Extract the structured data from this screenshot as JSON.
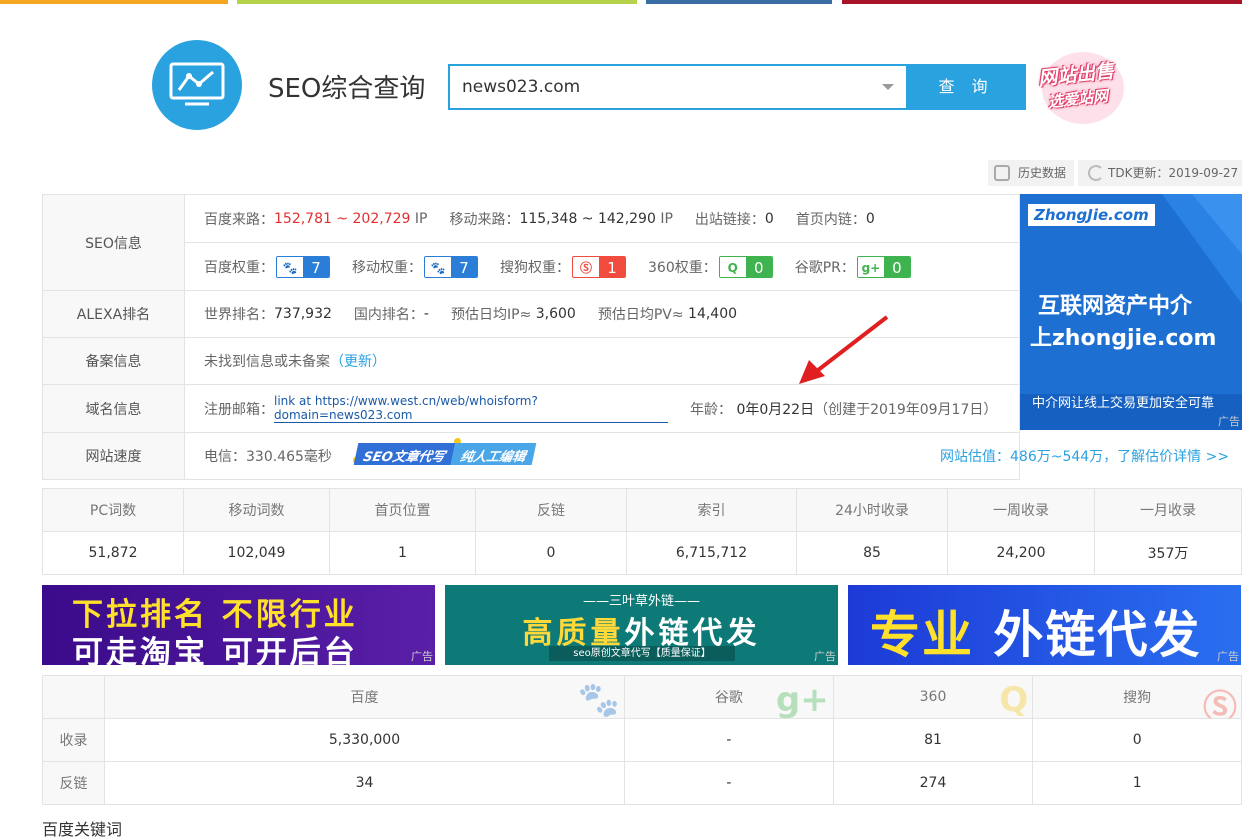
{
  "header": {
    "title": "SEO综合查询",
    "search_value": "news023.com",
    "search_button": "查 询",
    "sale_badge_line1": "网站出售",
    "sale_badge_line2": "选爱站网"
  },
  "toolbar": {
    "history": "历史数据",
    "tdk": "TDK更新：2019-09-27"
  },
  "seo_info": {
    "label": "SEO信息",
    "baidu_traffic_label": "百度来路：",
    "baidu_traffic_value": "152,781 ~ 202,729",
    "baidu_traffic_unit": "IP",
    "mobile_traffic_label": "移动来路：",
    "mobile_traffic_value": "115,348 ~ 142,290",
    "mobile_traffic_unit": "IP",
    "outlinks_label": "出站链接：",
    "outlinks_value": "0",
    "homepage_links_label": "首页内链：",
    "homepage_links_value": "0",
    "baidu_weight_label": "百度权重：",
    "baidu_weight_value": "7",
    "mobile_weight_label": "移动权重：",
    "mobile_weight_value": "7",
    "sogou_weight_label": "搜狗权重：",
    "sogou_weight_value": "1",
    "weight360_label": "360权重：",
    "weight360_value": "0",
    "google_pr_label": "谷歌PR：",
    "google_pr_value": "0"
  },
  "alexa": {
    "label": "ALEXA排名",
    "world_label": "世界排名：",
    "world_value": "737,932",
    "domestic_label": "国内排名：",
    "domestic_value": "-",
    "ip_label": "预估日均IP≈",
    "ip_value": "3,600",
    "pv_label": "预估日均PV≈",
    "pv_value": "14,400"
  },
  "beian": {
    "label": "备案信息",
    "text": "未找到信息或未备案",
    "update": "（更新）"
  },
  "domain": {
    "label": "域名信息",
    "email_label": "注册邮箱：",
    "email_link": "link at https://www.west.cn/web/whoisform?domain=news023.com",
    "age_label": "年龄：",
    "age_value": "0年0月22日",
    "created": "（创建于2019年09月17日）"
  },
  "speed": {
    "label": "网站速度",
    "telecom": "电信：330.465毫秒",
    "tag_a": "SEO文章代写",
    "tag_b": "纯人工编辑",
    "estimate": "网站估值：486万~544万，了解估价详情 >>"
  },
  "side_ad": {
    "logo": "ZhongJie.com",
    "line1": "互联网资产中介",
    "line2": "上zhongjie.com",
    "line3": "中介网让线上交易更加安全可靠",
    "ad": "广告"
  },
  "stats": {
    "headers": [
      "PC词数",
      "移动词数",
      "首页位置",
      "反链",
      "索引",
      "24小时收录",
      "一周收录",
      "一月收录"
    ],
    "values": [
      "51,872",
      "102,049",
      "1",
      "0",
      "6,715,712",
      "85",
      "24,200",
      "357万"
    ]
  },
  "banners": {
    "b1_line1": "下拉排名 不限行业",
    "b1_line2": "可走淘宝 可开后台",
    "b2_top": "——三叶草外链——",
    "b2_main_yellow": "高质量",
    "b2_main_white": "外链代发",
    "b2_sub": "seo原创文章代写【质量保证】",
    "b3_yellow": "专业",
    "b3_white": "外链代发",
    "ad": "广告"
  },
  "engines": {
    "headers": [
      "百度",
      "谷歌",
      "360",
      "搜狗"
    ],
    "rows": [
      {
        "label": "收录",
        "values": [
          "5,330,000",
          "-",
          "81",
          "0"
        ]
      },
      {
        "label": "反链",
        "values": [
          "34",
          "-",
          "274",
          "1"
        ]
      }
    ]
  },
  "footer": {
    "section": "百度关键词"
  },
  "colors": {
    "accent": "#2ba2e0",
    "red": "#e23030",
    "baidu_badge": "#2b7ed8",
    "sogou_badge": "#f04b3d",
    "badge360": "#3fb34f",
    "google_badge": "#3fb34f"
  }
}
